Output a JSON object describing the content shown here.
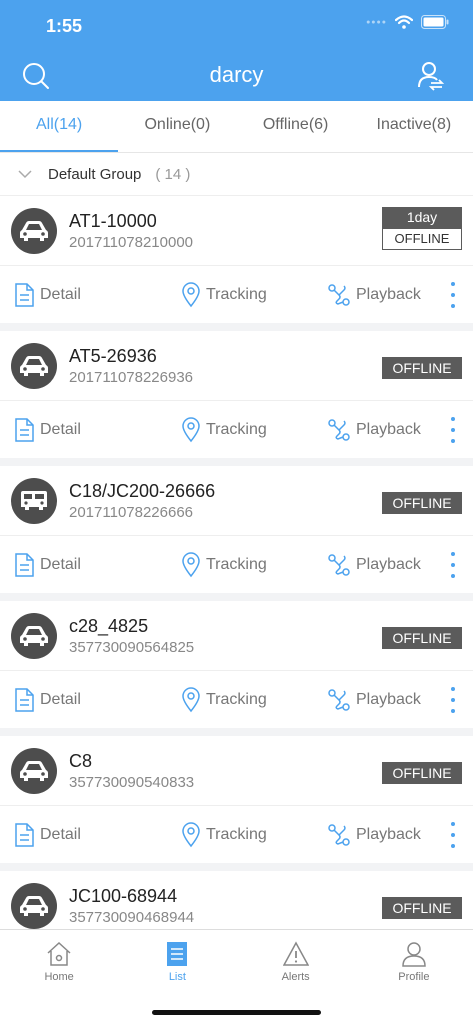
{
  "status": {
    "time": "1:55"
  },
  "header": {
    "title": "darcy"
  },
  "tabs": [
    {
      "label": "All(14)"
    },
    {
      "label": "Online(0)"
    },
    {
      "label": "Offline(6)"
    },
    {
      "label": "Inactive(8)"
    }
  ],
  "group": {
    "name": "Default Group",
    "count": "( 14 )"
  },
  "actions": {
    "detail": "Detail",
    "tracking": "Tracking",
    "playback": "Playback"
  },
  "devices": [
    {
      "name": "AT1-10000",
      "imei": "201711078210000",
      "days": "1day",
      "status": "OFFLINE",
      "icon": "car-icon"
    },
    {
      "name": "AT5-26936",
      "imei": "201711078226936",
      "status": "OFFLINE",
      "icon": "car-icon"
    },
    {
      "name": "C18/JC200-26666",
      "imei": "201711078226666",
      "status": "OFFLINE",
      "icon": "bus-icon"
    },
    {
      "name": "c28_4825",
      "imei": "357730090564825",
      "status": "OFFLINE",
      "icon": "car-icon"
    },
    {
      "name": "C8",
      "imei": "357730090540833",
      "status": "OFFLINE",
      "icon": "car-icon"
    },
    {
      "name": "JC100-68944",
      "imei": "357730090468944",
      "status": "OFFLINE",
      "icon": "car-icon"
    }
  ],
  "tabbar": [
    {
      "label": "Home",
      "icon": "home-icon"
    },
    {
      "label": "List",
      "icon": "list-icon"
    },
    {
      "label": "Alerts",
      "icon": "alert-icon"
    },
    {
      "label": "Profile",
      "icon": "profile-icon"
    }
  ],
  "colors": {
    "accent": "#4ca2ee",
    "badge": "#5b5b5b"
  }
}
